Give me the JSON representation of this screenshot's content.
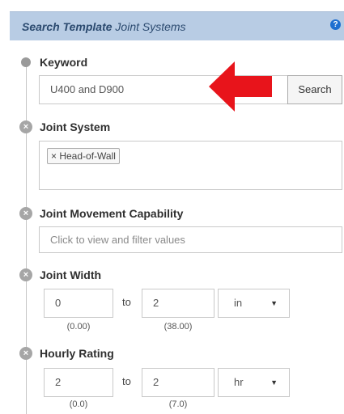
{
  "header": {
    "title_bold": "Search Template",
    "title_rest": "Joint Systems",
    "help_icon": "?"
  },
  "keyword": {
    "label": "Keyword",
    "value": "U400 and D900",
    "search_button": "Search"
  },
  "joint_system": {
    "label": "Joint System",
    "tags": [
      "× Head-of-Wall"
    ]
  },
  "movement": {
    "label": "Joint Movement Capability",
    "placeholder": "Click to view and filter values"
  },
  "width": {
    "label": "Joint Width",
    "from": "0",
    "to_label": "to",
    "to": "2",
    "unit": "in",
    "from_sub": "(0.00)",
    "to_sub": "(38.00)"
  },
  "hourly": {
    "label": "Hourly Rating",
    "from": "2",
    "to_label": "to",
    "to": "2",
    "unit": "hr",
    "from_sub": "(0.0)",
    "to_sub": "(7.0)"
  },
  "colors": {
    "header_bg": "#b8cce4",
    "help_icon": "#1f6fd0",
    "arrow": "#e8141b"
  },
  "icons": [
    "help-icon",
    "timeline-dot-icon",
    "remove-circle-icon",
    "dropdown-caret-icon",
    "red-arrow-icon"
  ]
}
